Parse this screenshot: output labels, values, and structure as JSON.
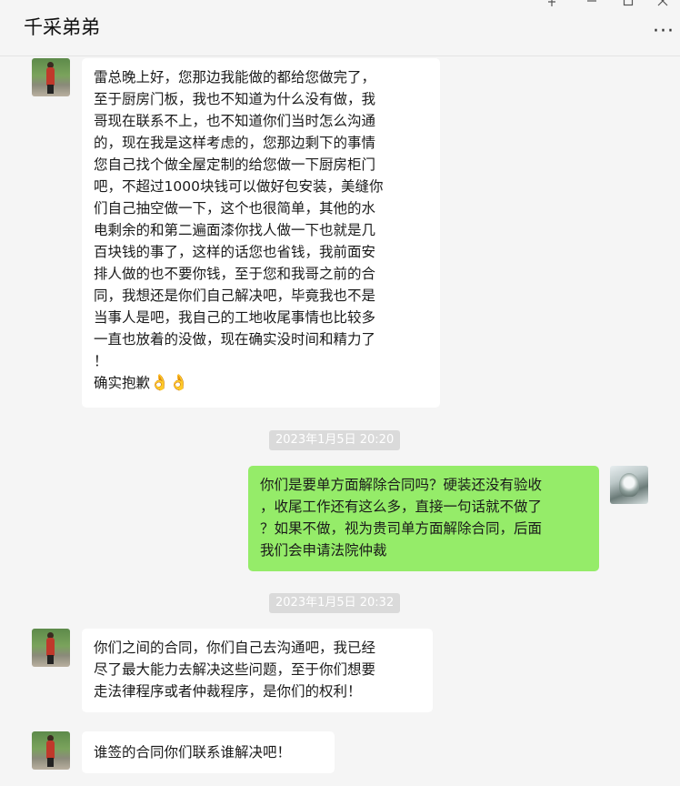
{
  "window": {
    "title": "千采弟弟",
    "pin_icon": "pin-icon",
    "minimize_icon": "minimize-icon",
    "maximize_icon": "maximize-icon",
    "more_label": "···"
  },
  "messages": [
    {
      "sender": "other",
      "lines": [
        "雷总晚上好，您那边我能做的都给您做完了，",
        "至于厨房门板，我也不知道为什么没有做，我",
        "哥现在联系不上，也不知道你们当时怎么沟通",
        "的，现在我是这样考虑的，您那边剩下的事情",
        "您自己找个做全屋定制的给您做一下厨房柜门",
        "吧，不超过1000块钱可以做好包安装，美缝你",
        "们自己抽空做一下，这个也很简单，其他的水",
        "电剩余的和第二遍面漆你找人做一下也就是几",
        "百块钱的事了，这样的话您也省钱，我前面安",
        "排人做的也不要你钱，至于您和我哥之前的合",
        "同，我想还是你们自己解决吧，毕竟我也不是",
        "当事人是吧，我自己的工地收尾事情也比较多",
        "一直也放着的没做，现在确实没时间和精力了",
        "！"
      ],
      "last_line": "确实抱歉",
      "emoji": "👌👌"
    },
    {
      "timestamp": "2023年1月5日 20:20"
    },
    {
      "sender": "me",
      "lines": [
        "你们是要单方面解除合同吗？硬装还没有验收",
        "，收尾工作还有这么多，直接一句话就不做了",
        "？如果不做，视为贵司单方面解除合同，后面",
        "我们会申请法院仲裁"
      ]
    },
    {
      "timestamp": "2023年1月5日 20:32"
    },
    {
      "sender": "other",
      "lines": [
        "你们之间的合同，你们自己去沟通吧，我已经",
        "尽了最大能力去解决这些问题，至于你们想要",
        "走法律程序或者仲裁程序，是你们的权利！"
      ]
    },
    {
      "sender": "other",
      "lines": [
        "谁签的合同你们联系谁解决吧！"
      ]
    }
  ]
}
